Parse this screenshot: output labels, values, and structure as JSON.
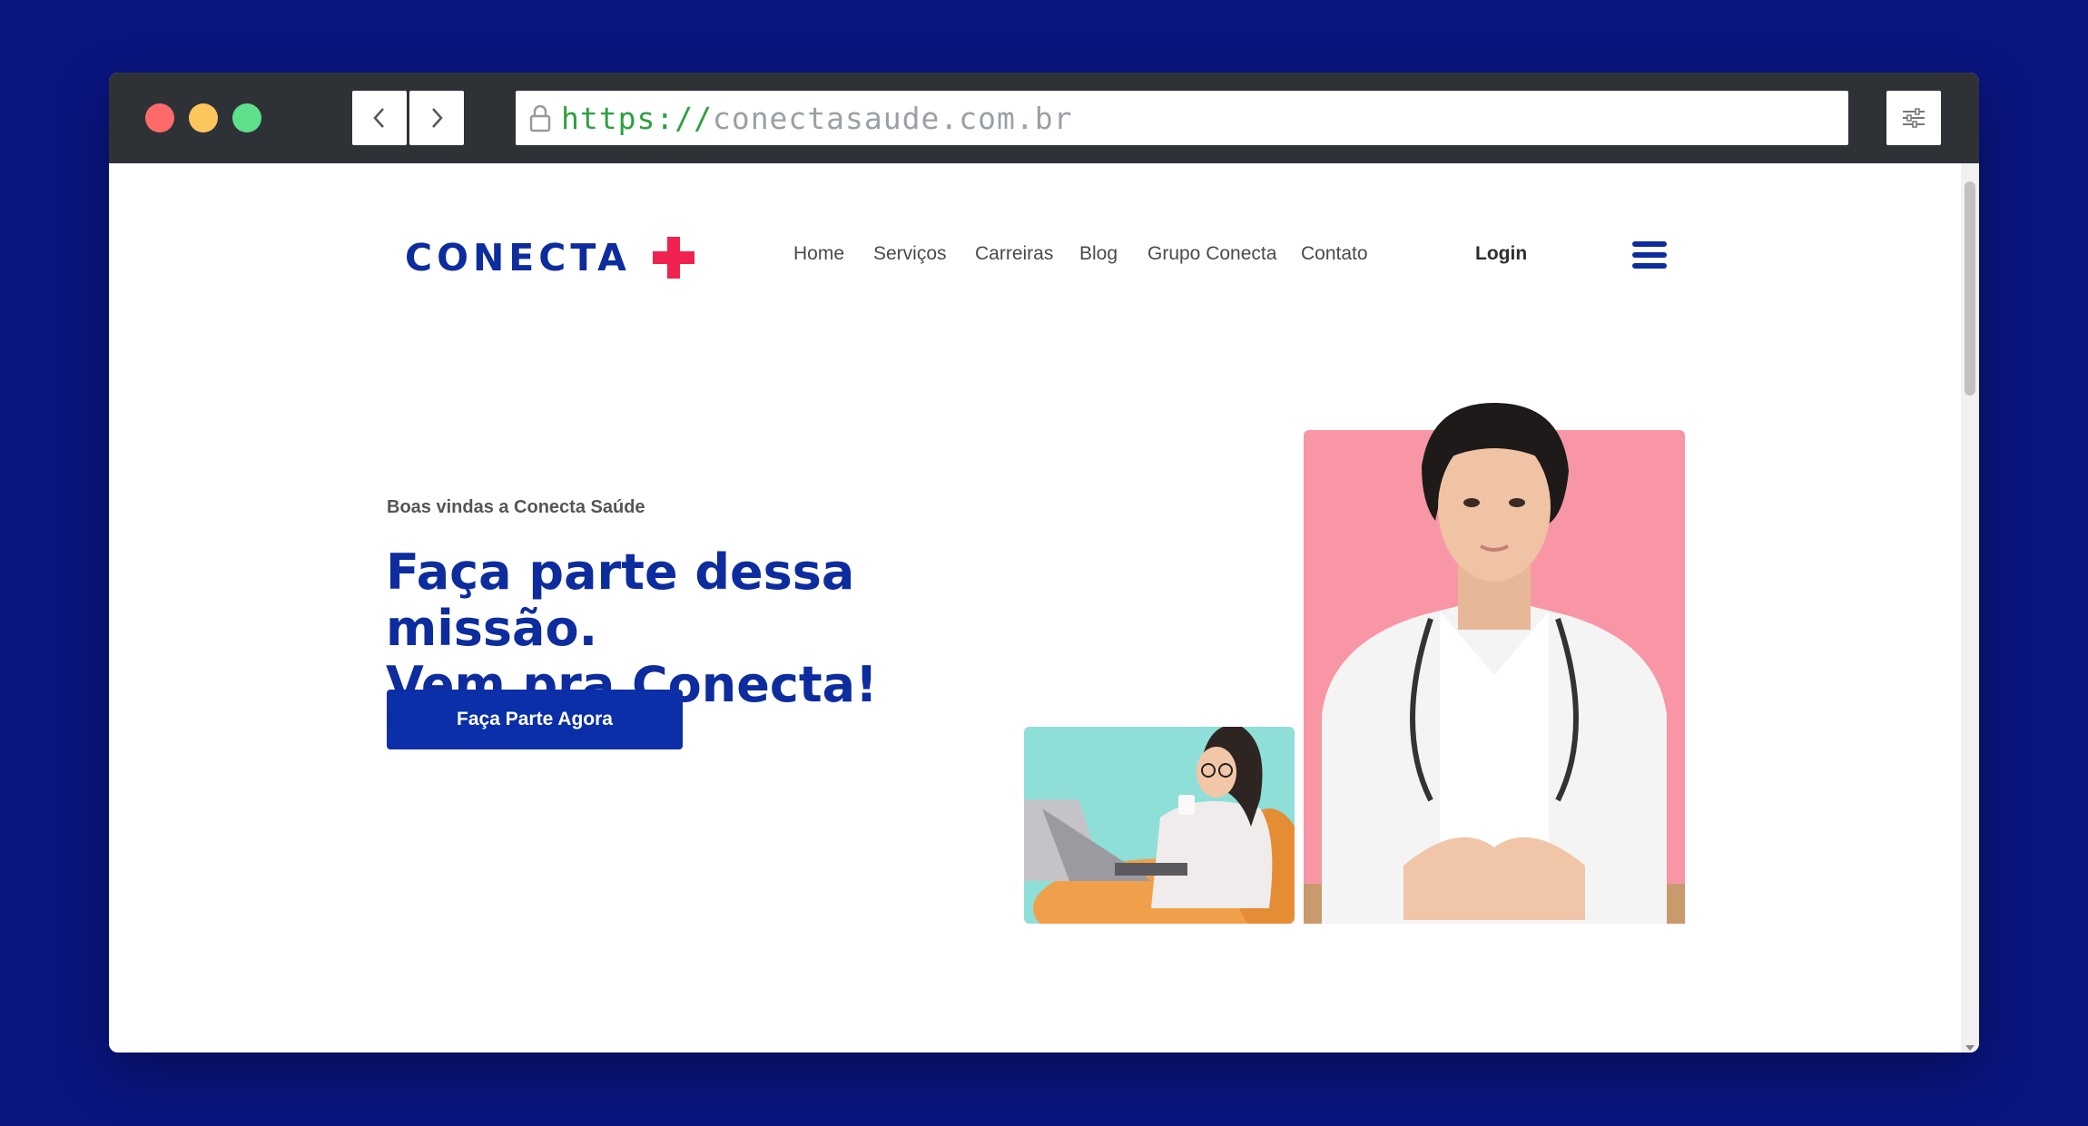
{
  "browser": {
    "url_scheme": "https://",
    "url_host": "conectasaude.com.br",
    "icons": {
      "back": "chevron-left-icon",
      "forward": "chevron-right-icon",
      "lock": "lock-icon",
      "menu": "sliders-icon"
    }
  },
  "site": {
    "logo_text": "CONECTA",
    "brand_colors": {
      "primary": "#0d2c9e",
      "accent": "#f0224f"
    },
    "nav": {
      "items": [
        "Home",
        "Serviços",
        "Carreiras",
        "Blog",
        "Grupo Conecta",
        "Contato"
      ],
      "login": "Login"
    },
    "hero": {
      "kicker": "Boas vindas a Conecta Saúde",
      "headline_line1": "Faça parte dessa missão.",
      "headline_line2": "Vem pra Conecta!",
      "cta": "Faça Parte Agora"
    }
  }
}
